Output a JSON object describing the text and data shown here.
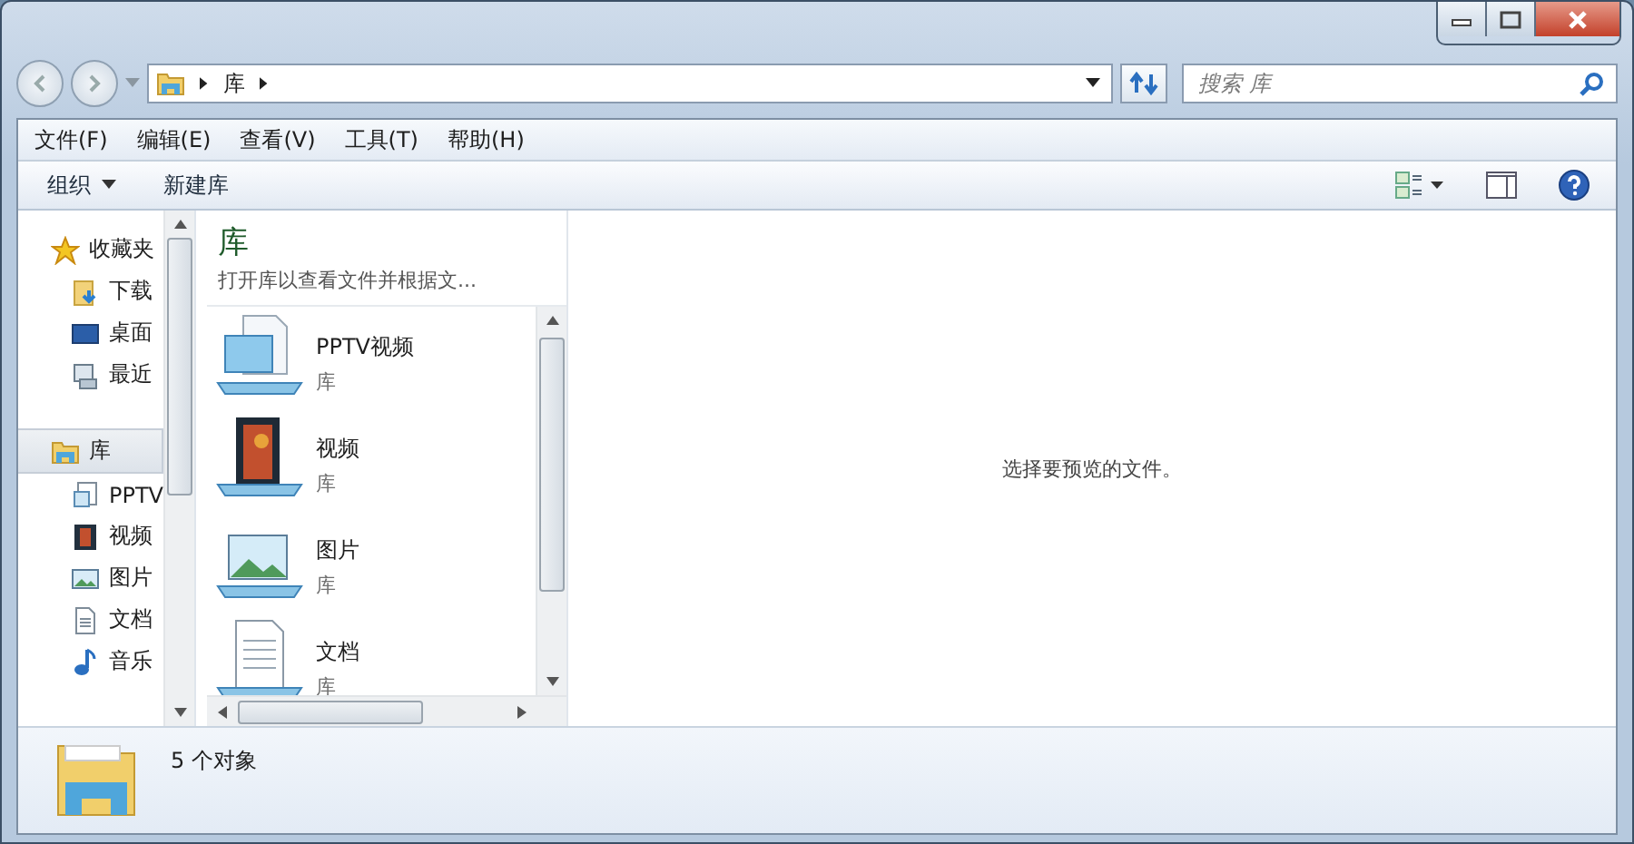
{
  "address_bar": {
    "segments": [
      "库"
    ]
  },
  "search": {
    "placeholder": "搜索 库"
  },
  "menu_bar": [
    "文件(F)",
    "编辑(E)",
    "查看(V)",
    "工具(T)",
    "帮助(H)"
  ],
  "toolbar": {
    "buttons": [
      {
        "label": "组织",
        "dropdown": true
      },
      {
        "label": "新建库",
        "dropdown": false
      }
    ]
  },
  "navigation": {
    "groups": [
      {
        "label": "收藏夹",
        "kind": "favorites",
        "selected": false,
        "children": [
          {
            "label": "下载",
            "kind": "download",
            "selected": false
          },
          {
            "label": "桌面",
            "kind": "desktop",
            "selected": false
          },
          {
            "label": "最近",
            "kind": "recent",
            "selected": false
          }
        ]
      },
      {
        "label": "库",
        "kind": "libraries",
        "selected": true,
        "children": [
          {
            "label": "PPTV",
            "kind": "pptv",
            "selected": false
          },
          {
            "label": "视频",
            "kind": "video",
            "selected": false
          },
          {
            "label": "图片",
            "kind": "picture",
            "selected": false
          },
          {
            "label": "文档",
            "kind": "document",
            "selected": false
          },
          {
            "label": "音乐",
            "kind": "music",
            "selected": false
          }
        ]
      }
    ]
  },
  "library_pane": {
    "title": "库",
    "description": "打开库以查看文件并根据文...",
    "items": [
      {
        "name": "PPTV视频",
        "type": "库",
        "kind": "pptv"
      },
      {
        "name": "视频",
        "type": "库",
        "kind": "video"
      },
      {
        "name": "图片",
        "type": "库",
        "kind": "picture"
      },
      {
        "name": "文档",
        "type": "库",
        "kind": "document"
      }
    ]
  },
  "preview": {
    "message": "选择要预览的文件。"
  },
  "status_bar": {
    "text": "5 个对象"
  }
}
